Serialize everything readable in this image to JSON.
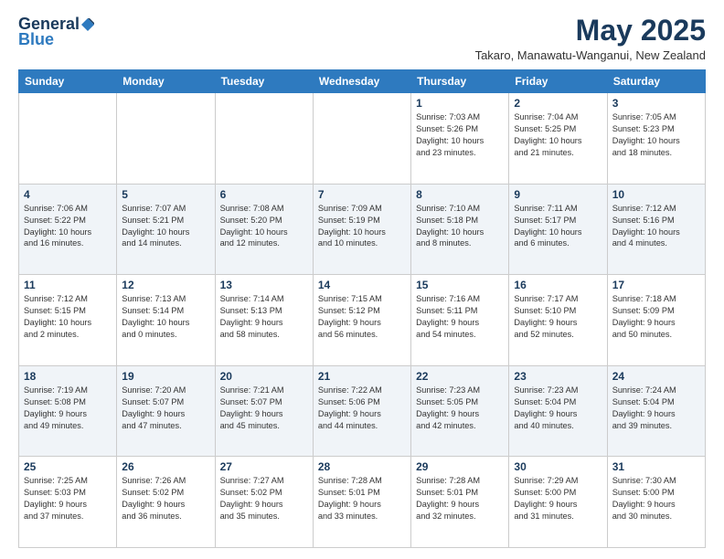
{
  "header": {
    "logo_general": "General",
    "logo_blue": "Blue",
    "month_title": "May 2025",
    "location": "Takaro, Manawatu-Wanganui, New Zealand"
  },
  "weekdays": [
    "Sunday",
    "Monday",
    "Tuesday",
    "Wednesday",
    "Thursday",
    "Friday",
    "Saturday"
  ],
  "weeks": [
    [
      {
        "day": "",
        "info": ""
      },
      {
        "day": "",
        "info": ""
      },
      {
        "day": "",
        "info": ""
      },
      {
        "day": "",
        "info": ""
      },
      {
        "day": "1",
        "info": "Sunrise: 7:03 AM\nSunset: 5:26 PM\nDaylight: 10 hours\nand 23 minutes."
      },
      {
        "day": "2",
        "info": "Sunrise: 7:04 AM\nSunset: 5:25 PM\nDaylight: 10 hours\nand 21 minutes."
      },
      {
        "day": "3",
        "info": "Sunrise: 7:05 AM\nSunset: 5:23 PM\nDaylight: 10 hours\nand 18 minutes."
      }
    ],
    [
      {
        "day": "4",
        "info": "Sunrise: 7:06 AM\nSunset: 5:22 PM\nDaylight: 10 hours\nand 16 minutes."
      },
      {
        "day": "5",
        "info": "Sunrise: 7:07 AM\nSunset: 5:21 PM\nDaylight: 10 hours\nand 14 minutes."
      },
      {
        "day": "6",
        "info": "Sunrise: 7:08 AM\nSunset: 5:20 PM\nDaylight: 10 hours\nand 12 minutes."
      },
      {
        "day": "7",
        "info": "Sunrise: 7:09 AM\nSunset: 5:19 PM\nDaylight: 10 hours\nand 10 minutes."
      },
      {
        "day": "8",
        "info": "Sunrise: 7:10 AM\nSunset: 5:18 PM\nDaylight: 10 hours\nand 8 minutes."
      },
      {
        "day": "9",
        "info": "Sunrise: 7:11 AM\nSunset: 5:17 PM\nDaylight: 10 hours\nand 6 minutes."
      },
      {
        "day": "10",
        "info": "Sunrise: 7:12 AM\nSunset: 5:16 PM\nDaylight: 10 hours\nand 4 minutes."
      }
    ],
    [
      {
        "day": "11",
        "info": "Sunrise: 7:12 AM\nSunset: 5:15 PM\nDaylight: 10 hours\nand 2 minutes."
      },
      {
        "day": "12",
        "info": "Sunrise: 7:13 AM\nSunset: 5:14 PM\nDaylight: 10 hours\nand 0 minutes."
      },
      {
        "day": "13",
        "info": "Sunrise: 7:14 AM\nSunset: 5:13 PM\nDaylight: 9 hours\nand 58 minutes."
      },
      {
        "day": "14",
        "info": "Sunrise: 7:15 AM\nSunset: 5:12 PM\nDaylight: 9 hours\nand 56 minutes."
      },
      {
        "day": "15",
        "info": "Sunrise: 7:16 AM\nSunset: 5:11 PM\nDaylight: 9 hours\nand 54 minutes."
      },
      {
        "day": "16",
        "info": "Sunrise: 7:17 AM\nSunset: 5:10 PM\nDaylight: 9 hours\nand 52 minutes."
      },
      {
        "day": "17",
        "info": "Sunrise: 7:18 AM\nSunset: 5:09 PM\nDaylight: 9 hours\nand 50 minutes."
      }
    ],
    [
      {
        "day": "18",
        "info": "Sunrise: 7:19 AM\nSunset: 5:08 PM\nDaylight: 9 hours\nand 49 minutes."
      },
      {
        "day": "19",
        "info": "Sunrise: 7:20 AM\nSunset: 5:07 PM\nDaylight: 9 hours\nand 47 minutes."
      },
      {
        "day": "20",
        "info": "Sunrise: 7:21 AM\nSunset: 5:07 PM\nDaylight: 9 hours\nand 45 minutes."
      },
      {
        "day": "21",
        "info": "Sunrise: 7:22 AM\nSunset: 5:06 PM\nDaylight: 9 hours\nand 44 minutes."
      },
      {
        "day": "22",
        "info": "Sunrise: 7:23 AM\nSunset: 5:05 PM\nDaylight: 9 hours\nand 42 minutes."
      },
      {
        "day": "23",
        "info": "Sunrise: 7:23 AM\nSunset: 5:04 PM\nDaylight: 9 hours\nand 40 minutes."
      },
      {
        "day": "24",
        "info": "Sunrise: 7:24 AM\nSunset: 5:04 PM\nDaylight: 9 hours\nand 39 minutes."
      }
    ],
    [
      {
        "day": "25",
        "info": "Sunrise: 7:25 AM\nSunset: 5:03 PM\nDaylight: 9 hours\nand 37 minutes."
      },
      {
        "day": "26",
        "info": "Sunrise: 7:26 AM\nSunset: 5:02 PM\nDaylight: 9 hours\nand 36 minutes."
      },
      {
        "day": "27",
        "info": "Sunrise: 7:27 AM\nSunset: 5:02 PM\nDaylight: 9 hours\nand 35 minutes."
      },
      {
        "day": "28",
        "info": "Sunrise: 7:28 AM\nSunset: 5:01 PM\nDaylight: 9 hours\nand 33 minutes."
      },
      {
        "day": "29",
        "info": "Sunrise: 7:28 AM\nSunset: 5:01 PM\nDaylight: 9 hours\nand 32 minutes."
      },
      {
        "day": "30",
        "info": "Sunrise: 7:29 AM\nSunset: 5:00 PM\nDaylight: 9 hours\nand 31 minutes."
      },
      {
        "day": "31",
        "info": "Sunrise: 7:30 AM\nSunset: 5:00 PM\nDaylight: 9 hours\nand 30 minutes."
      }
    ]
  ]
}
